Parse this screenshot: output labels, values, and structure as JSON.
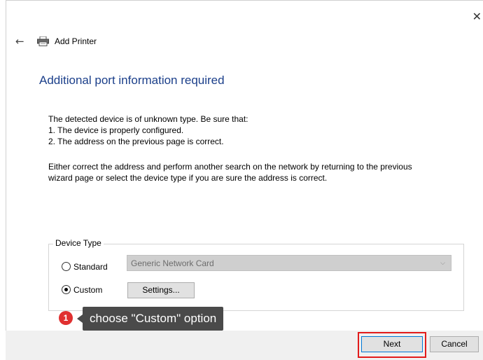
{
  "window": {
    "title": "Add Printer",
    "close_glyph": "✕",
    "back_glyph": "←"
  },
  "heading": "Additional port information required",
  "body": {
    "line1": "The detected device is of unknown type.  Be sure that:",
    "line2": "1. The device is properly configured.",
    "line3": "2.  The address on the previous page is correct.",
    "line4": "Either correct the address and perform another search on the network by returning to the previous",
    "line5": "wizard page or select the device type if you are sure the address is correct."
  },
  "device_type": {
    "group_label": "Device Type",
    "standard_label": "Standard",
    "standard_selected": false,
    "custom_label": "Custom",
    "custom_selected": true,
    "standard_value": "Generic Network Card",
    "settings_label": "Settings..."
  },
  "annotation": {
    "number": "1",
    "text": "choose \"Custom\" option"
  },
  "buttons": {
    "next": "Next",
    "cancel": "Cancel"
  },
  "colors": {
    "heading": "#1b3f8a",
    "highlight": "#e21b1b",
    "tooltip_bg": "#4a4a4a",
    "badge": "#e03030"
  },
  "icons": {
    "back": "back-arrow-icon",
    "printer": "printer-icon",
    "close": "close-icon",
    "dropdown": "chevron-down-icon"
  }
}
